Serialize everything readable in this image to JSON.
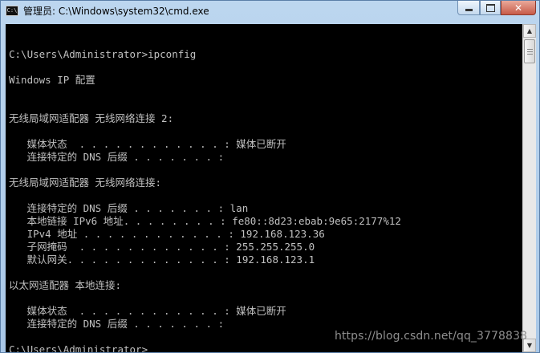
{
  "window": {
    "title": "管理员: C:\\Windows\\system32\\cmd.exe",
    "icon_text": "C:\\",
    "controls": {
      "minimize": "minimize-icon",
      "maximize": "maximize-icon",
      "close": "close-icon",
      "close_glyph": "✕"
    }
  },
  "console": {
    "lines": [
      "",
      "C:\\Users\\Administrator>ipconfig",
      "",
      "Windows IP 配置",
      "",
      "",
      "无线局域网适配器 无线网络连接 2:",
      "",
      "   媒体状态  . . . . . . . . . . . . : 媒体已断开",
      "   连接特定的 DNS 后缀 . . . . . . . :",
      "",
      "无线局域网适配器 无线网络连接:",
      "",
      "   连接特定的 DNS 后缀 . . . . . . . : lan",
      "   本地链接 IPv6 地址. . . . . . . . : fe80::8d23:ebab:9e65:2177%12",
      "   IPv4 地址 . . . . . . . . . . . . : 192.168.123.36",
      "   子网掩码  . . . . . . . . . . . . : 255.255.255.0",
      "   默认网关. . . . . . . . . . . . . : 192.168.123.1",
      "",
      "以太网适配器 本地连接:",
      "",
      "   媒体状态  . . . . . . . . . . . . : 媒体已断开",
      "   连接特定的 DNS 后缀 . . . . . . . :",
      "",
      "C:\\Users\\Administrator>"
    ]
  },
  "scrollbar": {
    "up_arrow": "▲",
    "down_arrow": "▼"
  },
  "watermark": "https://blog.csdn.net/qq_3778838"
}
